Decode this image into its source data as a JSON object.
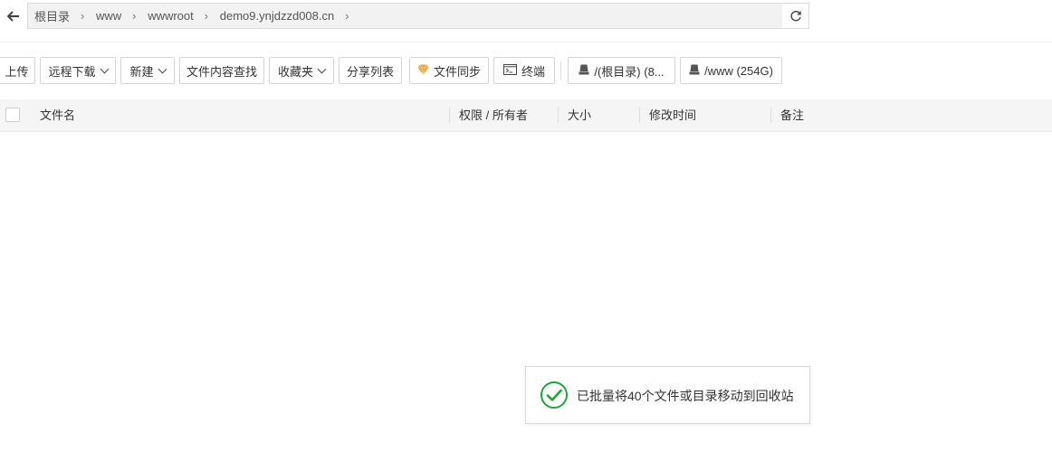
{
  "address_bar": {
    "breadcrumbs": [
      {
        "label": "根目录"
      },
      {
        "label": "www"
      },
      {
        "label": "wwwroot"
      },
      {
        "label": "demo9.ynjdzzd008.cn"
      }
    ]
  },
  "toolbar": {
    "upload": "上传",
    "remote_download": "远程下载",
    "new": "新建",
    "content_search": "文件内容查找",
    "favorites": "收藏夹",
    "share_list": "分享列表",
    "file_sync": "文件同步",
    "terminal": "终端",
    "disk_root": "/(根目录) (8...",
    "disk_www": "/www (254G)"
  },
  "table": {
    "columns": [
      "文件名",
      "权限 / 所有者",
      "大小",
      "修改时间",
      "备注"
    ],
    "rows": []
  },
  "toast": {
    "message": "已批量将40个文件或目录移动到回收站"
  },
  "colors": {
    "success": "#20a53a",
    "sync_icon": "#f0a030",
    "header_bg": "#f5f5f5"
  },
  "icons": {
    "back": "arrow-left-icon",
    "refresh": "refresh-icon",
    "sync": "diamond-icon",
    "terminal": "terminal-icon",
    "disk": "disk-icon",
    "toast": "check-circle-icon"
  }
}
